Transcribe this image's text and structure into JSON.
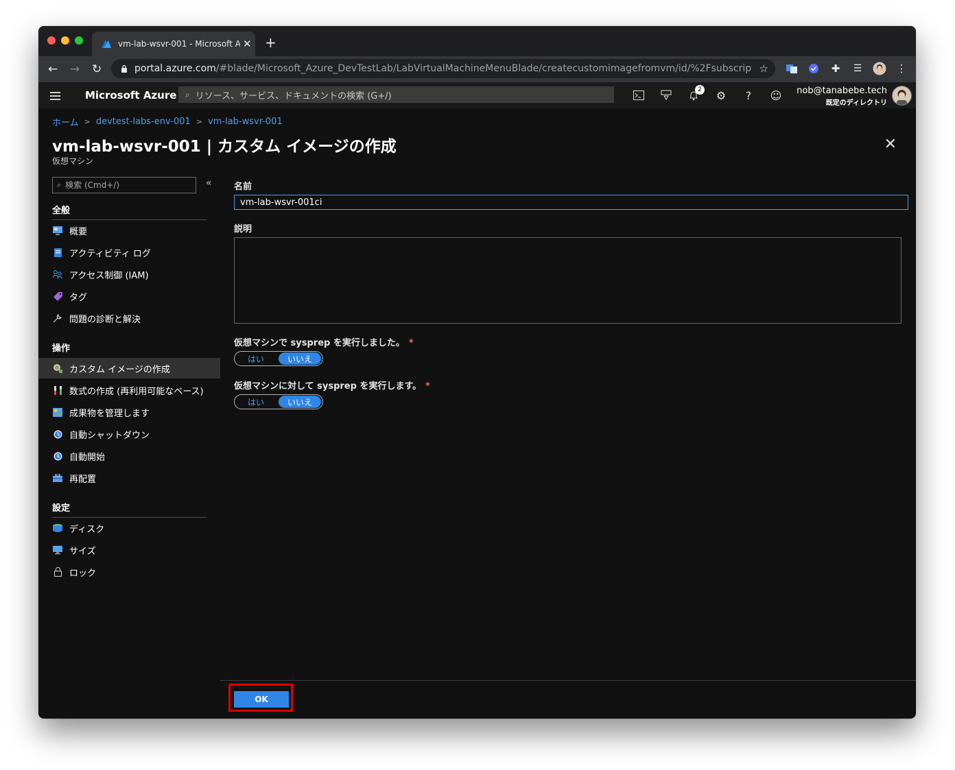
{
  "browser": {
    "tab_title": "vm-lab-wsvr-001 - Microsoft A",
    "new_tab_label": "+",
    "url_host": "portal.azure.com",
    "url_path": "/#blade/Microsoft_Azure_DevTestLab/LabVirtualMachineMenuBlade/createcustomimagefromvm/id/%2Fsubscriptions..."
  },
  "azure_bar": {
    "brand": "Microsoft Azure",
    "search_placeholder": "リソース、サービス、ドキュメントの検索 (G+/)",
    "notification_count": "2",
    "user_email": "nob@tanabebe.tech",
    "user_directory": "既定のディレクトリ"
  },
  "breadcrumb": [
    "ホーム",
    "devtest-labs-env-001",
    "vm-lab-wsvr-001"
  ],
  "page": {
    "title": "vm-lab-wsvr-001 | カスタム イメージの作成",
    "subtitle": "仮想マシン"
  },
  "sidebar": {
    "search_placeholder": "検索 (Cmd+/)",
    "sections": [
      {
        "header": "全般",
        "items": [
          "概要",
          "アクティビティ ログ",
          "アクセス制御 (IAM)",
          "タグ",
          "問題の診断と解決"
        ]
      },
      {
        "header": "操作",
        "items": [
          "カスタム イメージの作成",
          "数式の作成 (再利用可能なベース)",
          "成果物を管理します",
          "自動シャットダウン",
          "自動開始",
          "再配置"
        ]
      },
      {
        "header": "設定",
        "items": [
          "ディスク",
          "サイズ",
          "ロック"
        ]
      }
    ],
    "selected_item": "カスタム イメージの作成"
  },
  "form": {
    "name_label": "名前",
    "name_value": "vm-lab-wsvr-001ci",
    "description_label": "説明",
    "description_value": "",
    "sysprep_done_label": "仮想マシンで sysprep を実行しました。",
    "sysprep_run_label": "仮想マシンに対して sysprep を実行します。",
    "required_marker": "*",
    "yes_label": "はい",
    "no_label": "いいえ",
    "sysprep_done_selected": "いいえ",
    "sysprep_run_selected": "いいえ"
  },
  "footer": {
    "ok_label": "OK"
  },
  "colors": {
    "accent": "#2f86e6",
    "link": "#4aa0f0",
    "highlight": "#e00000",
    "background": "#111111"
  }
}
